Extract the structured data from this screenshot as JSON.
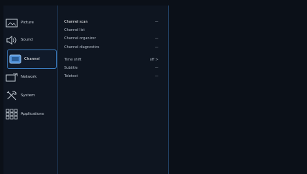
{
  "categories": [
    {
      "label": "Picture",
      "icon": "picture-icon"
    },
    {
      "label": "Sound",
      "icon": "speaker-icon"
    },
    {
      "label": "Channel",
      "icon": "channel-icon"
    },
    {
      "label": "Network",
      "icon": "network-icon"
    },
    {
      "label": "System",
      "icon": "tools-icon"
    },
    {
      "label": "Applications",
      "icon": "apps-icon"
    }
  ],
  "active_category": "Channel",
  "menu_items": [
    {
      "label": "Channel scan",
      "value": "—"
    },
    {
      "label": "Channel list",
      "value": ""
    },
    {
      "label": "Channel organizer",
      "value": "—"
    },
    {
      "label": "Channel diagnostics",
      "value": "—"
    },
    {
      "label": "Time shift",
      "value": "off >"
    },
    {
      "label": "Subtitle",
      "value": "—"
    },
    {
      "label": "Teletext",
      "value": "—"
    }
  ],
  "colors": {
    "accent": "#3c7fc3",
    "background": "#0b1018",
    "panel": "#0f1622"
  }
}
